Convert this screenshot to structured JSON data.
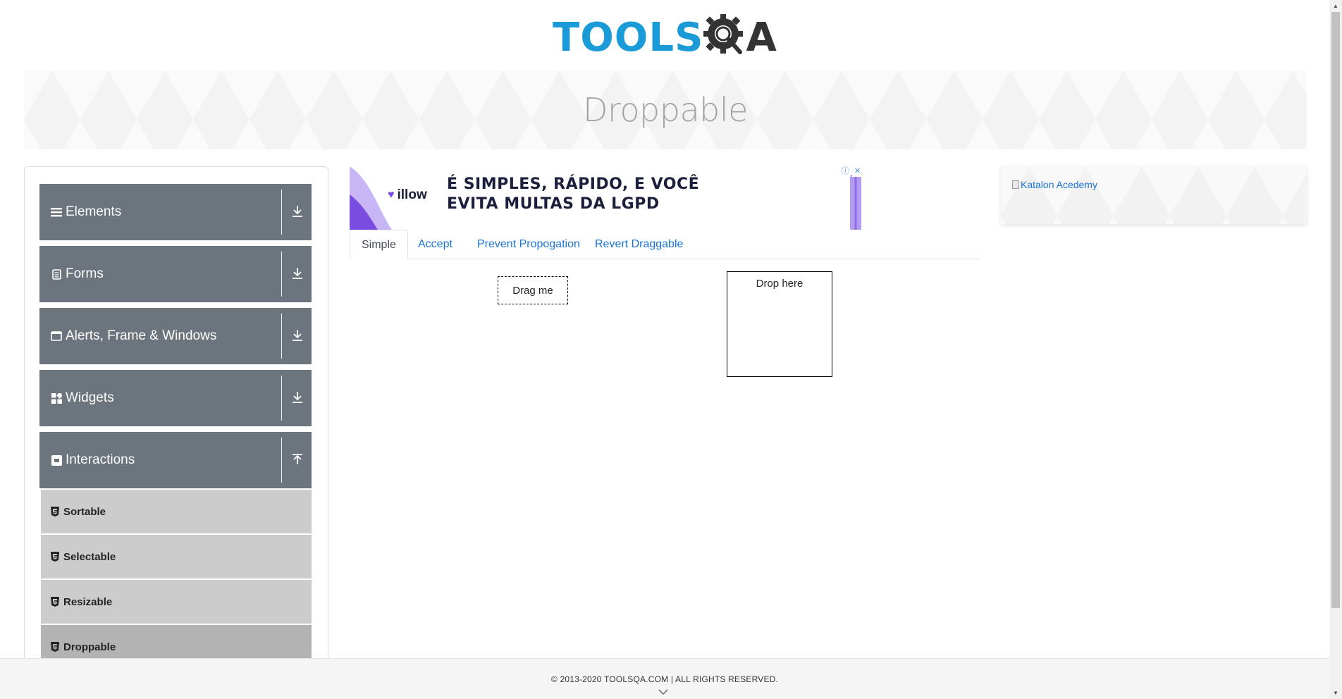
{
  "header": {
    "logo_tools": "TOOLS",
    "logo_q_icon": "gear-magnifier-icon",
    "logo_a": "A"
  },
  "banner": {
    "title": "Droppable"
  },
  "sidebar": {
    "groups": [
      {
        "label": "Elements",
        "icon": "hamburger-icon",
        "arrow": "download-arrow-icon"
      },
      {
        "label": "Forms",
        "icon": "document-icon",
        "arrow": "download-arrow-icon"
      },
      {
        "label": "Alerts, Frame & Windows",
        "icon": "window-icon",
        "arrow": "download-arrow-icon"
      },
      {
        "label": "Widgets",
        "icon": "widgets-icon",
        "arrow": "download-arrow-icon"
      },
      {
        "label": "Interactions",
        "icon": "interactions-icon",
        "arrow": "upload-arrow-icon"
      }
    ],
    "items": [
      {
        "label": "Sortable",
        "icon": "html5-icon"
      },
      {
        "label": "Selectable",
        "icon": "html5-icon"
      },
      {
        "label": "Resizable",
        "icon": "html5-icon"
      },
      {
        "label": "Droppable",
        "icon": "html5-icon",
        "active": true
      }
    ]
  },
  "ad": {
    "brand": "illow",
    "line1": "É SIMPLES, RÁPIDO, E VOCÊ",
    "line2": "EVITA MULTAS DA LGPD",
    "info_icon": "ⓘ",
    "close_icon": "✕"
  },
  "tabs": [
    {
      "label": "Simple",
      "active": true
    },
    {
      "label": "Accept"
    },
    {
      "label": "Prevent Propogation"
    },
    {
      "label": "Revert Draggable"
    }
  ],
  "draggable": {
    "label": "Drag me"
  },
  "droppable": {
    "label": "Drop here"
  },
  "right_ad": {
    "alt_text": "Katalon Acedemy"
  },
  "footer": {
    "text": "© 2013-2020 TOOLSQA.COM | ALL RIGHTS RESERVED."
  },
  "colors": {
    "brand_blue": "#1a9bd7",
    "sidebar_group_bg": "#6c757d",
    "sidebar_item_bg": "#cccccc",
    "sidebar_item_active_bg": "#b3b3b3",
    "link_blue": "#1a73d8"
  }
}
